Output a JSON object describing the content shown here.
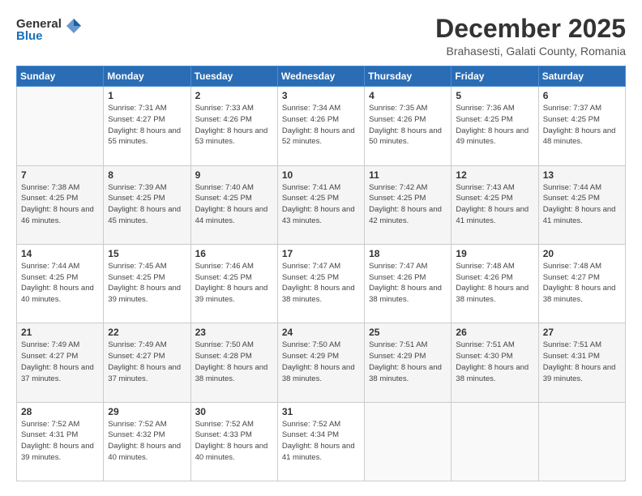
{
  "logo": {
    "general": "General",
    "blue": "Blue"
  },
  "header": {
    "month": "December 2025",
    "location": "Brahasesti, Galati County, Romania"
  },
  "weekdays": [
    "Sunday",
    "Monday",
    "Tuesday",
    "Wednesday",
    "Thursday",
    "Friday",
    "Saturday"
  ],
  "weeks": [
    [
      {
        "day": "",
        "sunrise": "",
        "sunset": "",
        "daylight": ""
      },
      {
        "day": "1",
        "sunrise": "Sunrise: 7:31 AM",
        "sunset": "Sunset: 4:27 PM",
        "daylight": "Daylight: 8 hours and 55 minutes."
      },
      {
        "day": "2",
        "sunrise": "Sunrise: 7:33 AM",
        "sunset": "Sunset: 4:26 PM",
        "daylight": "Daylight: 8 hours and 53 minutes."
      },
      {
        "day": "3",
        "sunrise": "Sunrise: 7:34 AM",
        "sunset": "Sunset: 4:26 PM",
        "daylight": "Daylight: 8 hours and 52 minutes."
      },
      {
        "day": "4",
        "sunrise": "Sunrise: 7:35 AM",
        "sunset": "Sunset: 4:26 PM",
        "daylight": "Daylight: 8 hours and 50 minutes."
      },
      {
        "day": "5",
        "sunrise": "Sunrise: 7:36 AM",
        "sunset": "Sunset: 4:25 PM",
        "daylight": "Daylight: 8 hours and 49 minutes."
      },
      {
        "day": "6",
        "sunrise": "Sunrise: 7:37 AM",
        "sunset": "Sunset: 4:25 PM",
        "daylight": "Daylight: 8 hours and 48 minutes."
      }
    ],
    [
      {
        "day": "7",
        "sunrise": "Sunrise: 7:38 AM",
        "sunset": "Sunset: 4:25 PM",
        "daylight": "Daylight: 8 hours and 46 minutes."
      },
      {
        "day": "8",
        "sunrise": "Sunrise: 7:39 AM",
        "sunset": "Sunset: 4:25 PM",
        "daylight": "Daylight: 8 hours and 45 minutes."
      },
      {
        "day": "9",
        "sunrise": "Sunrise: 7:40 AM",
        "sunset": "Sunset: 4:25 PM",
        "daylight": "Daylight: 8 hours and 44 minutes."
      },
      {
        "day": "10",
        "sunrise": "Sunrise: 7:41 AM",
        "sunset": "Sunset: 4:25 PM",
        "daylight": "Daylight: 8 hours and 43 minutes."
      },
      {
        "day": "11",
        "sunrise": "Sunrise: 7:42 AM",
        "sunset": "Sunset: 4:25 PM",
        "daylight": "Daylight: 8 hours and 42 minutes."
      },
      {
        "day": "12",
        "sunrise": "Sunrise: 7:43 AM",
        "sunset": "Sunset: 4:25 PM",
        "daylight": "Daylight: 8 hours and 41 minutes."
      },
      {
        "day": "13",
        "sunrise": "Sunrise: 7:44 AM",
        "sunset": "Sunset: 4:25 PM",
        "daylight": "Daylight: 8 hours and 41 minutes."
      }
    ],
    [
      {
        "day": "14",
        "sunrise": "Sunrise: 7:44 AM",
        "sunset": "Sunset: 4:25 PM",
        "daylight": "Daylight: 8 hours and 40 minutes."
      },
      {
        "day": "15",
        "sunrise": "Sunrise: 7:45 AM",
        "sunset": "Sunset: 4:25 PM",
        "daylight": "Daylight: 8 hours and 39 minutes."
      },
      {
        "day": "16",
        "sunrise": "Sunrise: 7:46 AM",
        "sunset": "Sunset: 4:25 PM",
        "daylight": "Daylight: 8 hours and 39 minutes."
      },
      {
        "day": "17",
        "sunrise": "Sunrise: 7:47 AM",
        "sunset": "Sunset: 4:25 PM",
        "daylight": "Daylight: 8 hours and 38 minutes."
      },
      {
        "day": "18",
        "sunrise": "Sunrise: 7:47 AM",
        "sunset": "Sunset: 4:26 PM",
        "daylight": "Daylight: 8 hours and 38 minutes."
      },
      {
        "day": "19",
        "sunrise": "Sunrise: 7:48 AM",
        "sunset": "Sunset: 4:26 PM",
        "daylight": "Daylight: 8 hours and 38 minutes."
      },
      {
        "day": "20",
        "sunrise": "Sunrise: 7:48 AM",
        "sunset": "Sunset: 4:27 PM",
        "daylight": "Daylight: 8 hours and 38 minutes."
      }
    ],
    [
      {
        "day": "21",
        "sunrise": "Sunrise: 7:49 AM",
        "sunset": "Sunset: 4:27 PM",
        "daylight": "Daylight: 8 hours and 37 minutes."
      },
      {
        "day": "22",
        "sunrise": "Sunrise: 7:49 AM",
        "sunset": "Sunset: 4:27 PM",
        "daylight": "Daylight: 8 hours and 37 minutes."
      },
      {
        "day": "23",
        "sunrise": "Sunrise: 7:50 AM",
        "sunset": "Sunset: 4:28 PM",
        "daylight": "Daylight: 8 hours and 38 minutes."
      },
      {
        "day": "24",
        "sunrise": "Sunrise: 7:50 AM",
        "sunset": "Sunset: 4:29 PM",
        "daylight": "Daylight: 8 hours and 38 minutes."
      },
      {
        "day": "25",
        "sunrise": "Sunrise: 7:51 AM",
        "sunset": "Sunset: 4:29 PM",
        "daylight": "Daylight: 8 hours and 38 minutes."
      },
      {
        "day": "26",
        "sunrise": "Sunrise: 7:51 AM",
        "sunset": "Sunset: 4:30 PM",
        "daylight": "Daylight: 8 hours and 38 minutes."
      },
      {
        "day": "27",
        "sunrise": "Sunrise: 7:51 AM",
        "sunset": "Sunset: 4:31 PM",
        "daylight": "Daylight: 8 hours and 39 minutes."
      }
    ],
    [
      {
        "day": "28",
        "sunrise": "Sunrise: 7:52 AM",
        "sunset": "Sunset: 4:31 PM",
        "daylight": "Daylight: 8 hours and 39 minutes."
      },
      {
        "day": "29",
        "sunrise": "Sunrise: 7:52 AM",
        "sunset": "Sunset: 4:32 PM",
        "daylight": "Daylight: 8 hours and 40 minutes."
      },
      {
        "day": "30",
        "sunrise": "Sunrise: 7:52 AM",
        "sunset": "Sunset: 4:33 PM",
        "daylight": "Daylight: 8 hours and 40 minutes."
      },
      {
        "day": "31",
        "sunrise": "Sunrise: 7:52 AM",
        "sunset": "Sunset: 4:34 PM",
        "daylight": "Daylight: 8 hours and 41 minutes."
      },
      {
        "day": "",
        "sunrise": "",
        "sunset": "",
        "daylight": ""
      },
      {
        "day": "",
        "sunrise": "",
        "sunset": "",
        "daylight": ""
      },
      {
        "day": "",
        "sunrise": "",
        "sunset": "",
        "daylight": ""
      }
    ]
  ]
}
